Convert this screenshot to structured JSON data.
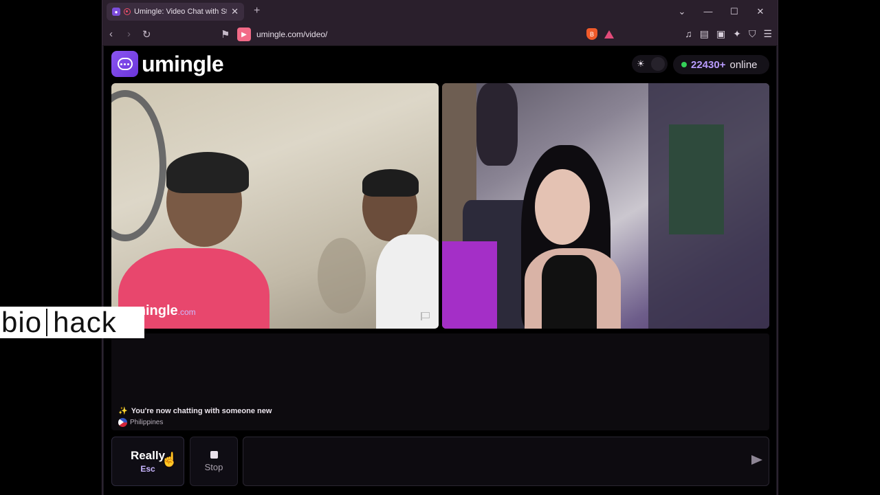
{
  "browser": {
    "tab_title": "Umingle: Video Chat with Stra",
    "url": "umingle.com/video/"
  },
  "site": {
    "logo_text": "umingle",
    "online_count": "22430+",
    "online_label": "online"
  },
  "video_local": {
    "watermark_brand": "umingle",
    "watermark_tld": ".com"
  },
  "chat": {
    "system_message": "You're now chatting with someone new",
    "country": "Philippines"
  },
  "controls": {
    "skip_label": "Really",
    "skip_hint": "Esc",
    "stop_label": "Stop",
    "message_value": ""
  },
  "overlay": {
    "logo_left": "bio",
    "logo_right": "hack"
  },
  "colors": {
    "accent": "#8a55f2",
    "online_dot": "#34d058",
    "online_count": "#b99cff"
  }
}
